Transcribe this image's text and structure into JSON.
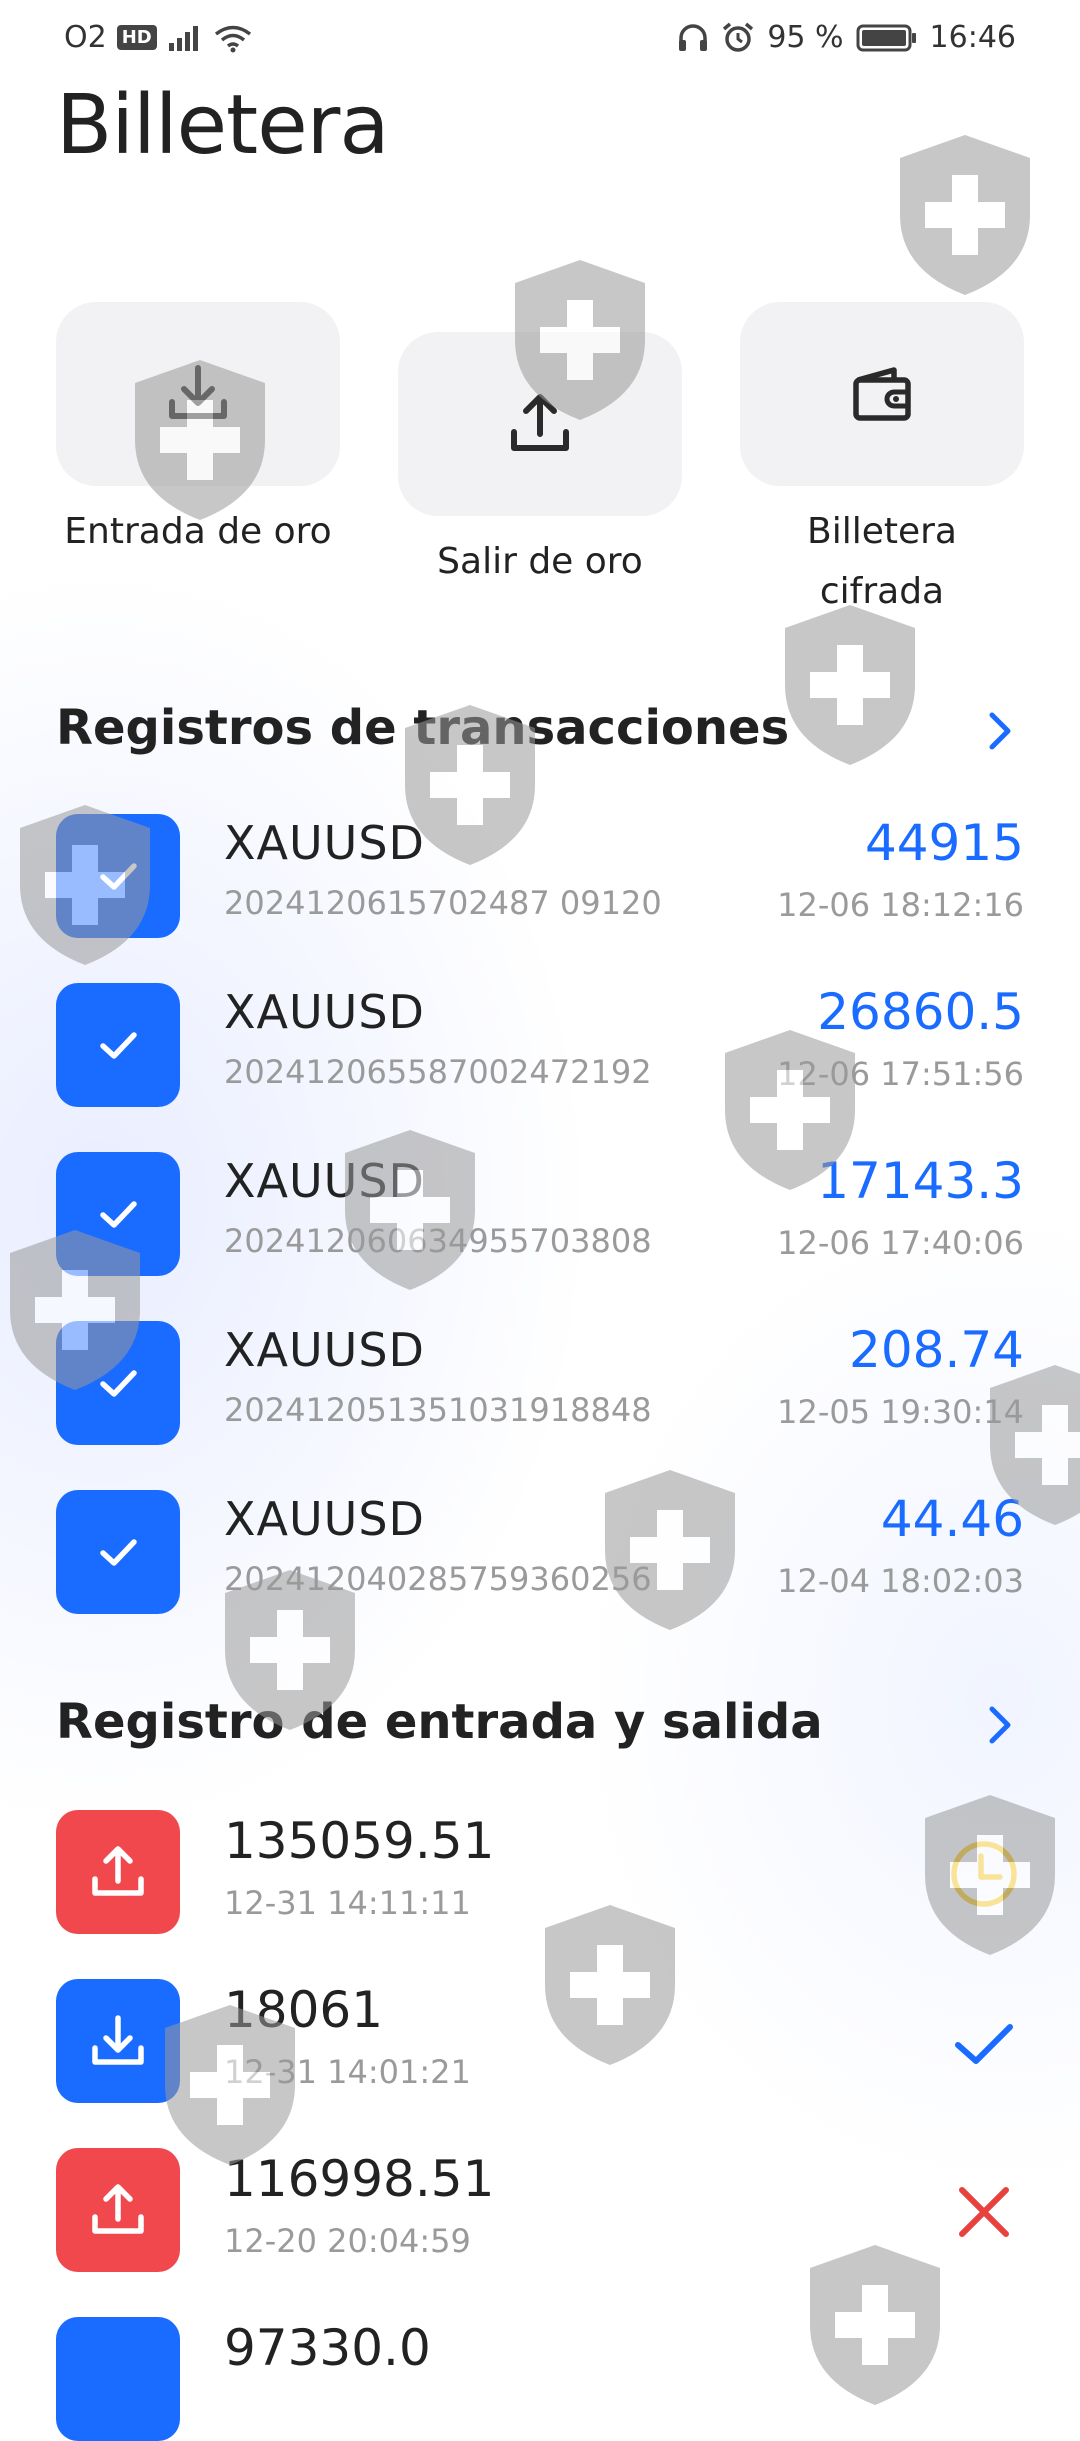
{
  "status_bar": {
    "carrier": "O2",
    "hd": "HD",
    "battery": "95 %",
    "time": "16:46"
  },
  "page": {
    "title": "Billetera"
  },
  "actions": [
    {
      "label": "Entrada de oro",
      "icon": "download-tray-icon"
    },
    {
      "label": "Salir de oro",
      "icon": "upload-tray-icon"
    },
    {
      "label": "Billetera cifrada",
      "icon": "wallet-icon"
    }
  ],
  "transactions": {
    "title": "Registros de transacciones",
    "items": [
      {
        "symbol": "XAUUSD",
        "id": "2024120615702487 09120",
        "amount": "44915",
        "time": "12-06 18:12:16"
      },
      {
        "symbol": "XAUUSD",
        "id": "202412065587002472192",
        "amount": "26860.5",
        "time": "12-06 17:51:56"
      },
      {
        "symbol": "XAUUSD",
        "id": "202412060634955703808",
        "amount": "17143.3",
        "time": "12-06 17:40:06"
      },
      {
        "symbol": "XAUUSD",
        "id": "202412051351031918848",
        "amount": "208.74",
        "time": "12-05 19:30:14"
      },
      {
        "symbol": "XAUUSD",
        "id": "202412040285759360256",
        "amount": "44.46",
        "time": "12-04 18:02:03"
      }
    ]
  },
  "io_records": {
    "title": "Registro de entrada y salida",
    "items": [
      {
        "type": "out",
        "amount": "135059.51",
        "time": "12-31 14:11:11",
        "status": "pending"
      },
      {
        "type": "in",
        "amount": "18061",
        "time": "12-31 14:01:21",
        "status": "success"
      },
      {
        "type": "out",
        "amount": "116998.51",
        "time": "12-20 20:04:59",
        "status": "failed"
      },
      {
        "type": "in",
        "amount": "97330.0",
        "time": "",
        "status": ""
      }
    ]
  },
  "colors": {
    "accent": "#1a6bff",
    "danger": "#f0484d",
    "pending": "#f2c21b",
    "success": "#1a6bff",
    "failed": "#e8413e"
  }
}
